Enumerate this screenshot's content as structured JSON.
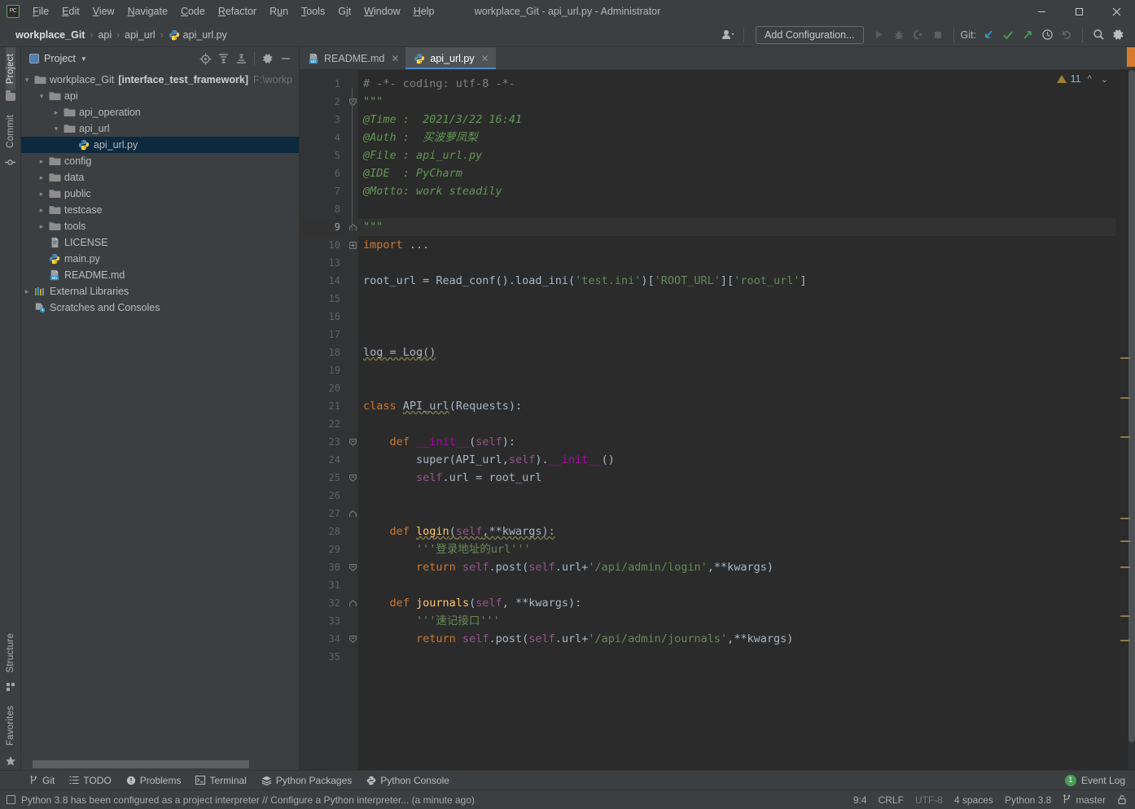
{
  "window": {
    "title": "workplace_Git - api_url.py - Administrator",
    "app_icon": "pycharm-logo-icon",
    "controls": {
      "minimize": "—",
      "maximize": "☐",
      "close": "✕"
    }
  },
  "menubar": {
    "items": [
      {
        "label": "File",
        "mnemonic": "F"
      },
      {
        "label": "Edit",
        "mnemonic": "E"
      },
      {
        "label": "View",
        "mnemonic": "V"
      },
      {
        "label": "Navigate",
        "mnemonic": "N"
      },
      {
        "label": "Code",
        "mnemonic": "C"
      },
      {
        "label": "Refactor",
        "mnemonic": "R"
      },
      {
        "label": "Run",
        "mnemonic": "u"
      },
      {
        "label": "Tools",
        "mnemonic": "T"
      },
      {
        "label": "Git",
        "mnemonic": "i"
      },
      {
        "label": "Window",
        "mnemonic": "W"
      },
      {
        "label": "Help",
        "mnemonic": "H"
      }
    ]
  },
  "navbar": {
    "breadcrumbs": [
      {
        "label": "workplace_Git",
        "bold": true,
        "icon": null
      },
      {
        "label": "api",
        "bold": false,
        "icon": null
      },
      {
        "label": "api_url",
        "bold": false,
        "icon": null
      },
      {
        "label": "api_url.py",
        "bold": false,
        "icon": "python-file-icon"
      }
    ],
    "separator": "›",
    "user_icon": "user-account-icon",
    "run_config_label": "Add Configuration...",
    "run_icon": "run-icon",
    "debug_icon": "debug-icon",
    "coverage_icon": "run-with-coverage-icon",
    "stop_icon": "stop-icon",
    "git_label": "Git:",
    "git_update_icon": "update-project-icon",
    "git_commit_icon": "commit-check-icon",
    "git_push_icon": "push-arrow-icon",
    "git_history_icon": "history-clock-icon",
    "git_rollback_icon": "rollback-icon",
    "search_icon": "search-icon",
    "settings_icon": "gear-icon"
  },
  "left_strip": {
    "top": [
      {
        "label": "Project",
        "icon": "project-folder-icon",
        "active": true
      },
      {
        "label": "Commit",
        "icon": "commit-icon",
        "active": false
      }
    ],
    "bottom": [
      {
        "label": "Structure",
        "icon": "structure-icon",
        "active": false
      },
      {
        "label": "Favorites",
        "icon": "star-icon",
        "active": false
      }
    ]
  },
  "project_panel": {
    "title": "Project",
    "title_icon": "project-view-icon",
    "dropdown_icon": "chevron-down-icon",
    "actions": [
      {
        "name": "scroll-from-source-icon"
      },
      {
        "name": "expand-all-icon"
      },
      {
        "name": "collapse-all-icon"
      },
      {
        "name": "gear-icon"
      },
      {
        "name": "hide-icon"
      }
    ],
    "tree": [
      {
        "depth": 0,
        "arrow": "down",
        "icon": "folder-icon",
        "label": "workplace_Git",
        "suffix": "[interface_test_framework]",
        "path": "F:\\workp",
        "selected": false
      },
      {
        "depth": 1,
        "arrow": "down",
        "icon": "folder-icon",
        "label": "api",
        "selected": false
      },
      {
        "depth": 2,
        "arrow": "right",
        "icon": "folder-icon",
        "label": "api_operation",
        "selected": false
      },
      {
        "depth": 2,
        "arrow": "down",
        "icon": "folder-icon",
        "label": "api_url",
        "selected": false
      },
      {
        "depth": 3,
        "arrow": "none",
        "icon": "python-file-icon",
        "label": "api_url.py",
        "selected": true
      },
      {
        "depth": 1,
        "arrow": "right",
        "icon": "folder-icon",
        "label": "config",
        "selected": false
      },
      {
        "depth": 1,
        "arrow": "right",
        "icon": "folder-icon",
        "label": "data",
        "selected": false
      },
      {
        "depth": 1,
        "arrow": "right",
        "icon": "folder-icon",
        "label": "public",
        "selected": false
      },
      {
        "depth": 1,
        "arrow": "right",
        "icon": "folder-icon",
        "label": "testcase",
        "selected": false
      },
      {
        "depth": 1,
        "arrow": "right",
        "icon": "folder-icon",
        "label": "tools",
        "selected": false
      },
      {
        "depth": 1,
        "arrow": "none",
        "icon": "license-file-icon",
        "label": "LICENSE",
        "selected": false
      },
      {
        "depth": 1,
        "arrow": "none",
        "icon": "python-file-icon",
        "label": "main.py",
        "selected": false
      },
      {
        "depth": 1,
        "arrow": "none",
        "icon": "markdown-file-icon",
        "label": "README.md",
        "selected": false
      },
      {
        "depth": 0,
        "arrow": "right",
        "icon": "external-libraries-icon",
        "label": "External Libraries",
        "selected": false
      },
      {
        "depth": 0,
        "arrow": "none",
        "icon": "scratches-icon",
        "label": "Scratches and Consoles",
        "selected": false
      }
    ]
  },
  "editor": {
    "tabs": [
      {
        "label": "README.md",
        "icon": "markdown-file-icon",
        "active": false,
        "close_icon": "close-icon"
      },
      {
        "label": "api_url.py",
        "icon": "python-file-icon",
        "active": true,
        "close_icon": "close-icon"
      }
    ],
    "inspector": {
      "warning_icon": "warning-triangle-icon",
      "warning_count": "11",
      "prev_icon": "chevron-up-icon",
      "next_icon": "chevron-down-icon"
    },
    "current_line": 9,
    "line_numbers": [
      1,
      2,
      3,
      4,
      5,
      6,
      7,
      8,
      9,
      10,
      13,
      14,
      15,
      16,
      17,
      18,
      19,
      20,
      21,
      22,
      23,
      24,
      25,
      26,
      27,
      28,
      29,
      30,
      31,
      32,
      33,
      34,
      35
    ],
    "code_lines": [
      {
        "n": 1,
        "html": "<span class=\"c-comment\"># -*- coding: utf-8 -*-</span>"
      },
      {
        "n": 2,
        "html": "<span class=\"c-doc\">\"\"\"</span>"
      },
      {
        "n": 3,
        "html": "<span class=\"c-doc\">@Time :  2021/3/22 16:41</span>"
      },
      {
        "n": 4,
        "html": "<span class=\"c-doc\">@Auth :  买波萝凤梨</span>"
      },
      {
        "n": 5,
        "html": "<span class=\"c-doc\">@File : api_url.py</span>"
      },
      {
        "n": 6,
        "html": "<span class=\"c-doc\">@IDE  : PyCharm</span>"
      },
      {
        "n": 7,
        "html": "<span class=\"c-doc\">@Motto: work steadily</span>"
      },
      {
        "n": 8,
        "html": ""
      },
      {
        "n": 9,
        "html": "<span class=\"c-doc\">\"\"\"</span>",
        "current": true
      },
      {
        "n": 10,
        "html": "<span class=\"c-kw\">import</span> <span class=\"c-default\">...</span>"
      },
      {
        "n": 13,
        "html": ""
      },
      {
        "n": 14,
        "html": "<span class=\"c-default\">root_url = Read_conf().load_ini(</span><span class=\"c-str\">'test.ini'</span><span class=\"c-default\">)[</span><span class=\"c-str\">'ROOT_URL'</span><span class=\"c-default\">][</span><span class=\"c-str\">'root_url'</span><span class=\"c-default\">]</span>"
      },
      {
        "n": 15,
        "html": ""
      },
      {
        "n": 16,
        "html": ""
      },
      {
        "n": 17,
        "html": ""
      },
      {
        "n": 18,
        "html": "<span class=\"c-default squig\">log = Log()</span>"
      },
      {
        "n": 19,
        "html": ""
      },
      {
        "n": 20,
        "html": ""
      },
      {
        "n": 21,
        "html": "<span class=\"c-kw\">class</span> <span class=\"c-default squig\">API_url</span><span class=\"c-default\">(Requests):</span>"
      },
      {
        "n": 22,
        "html": ""
      },
      {
        "n": 23,
        "html": "    <span class=\"c-kw\">def</span> <span class=\"c-dunder\">__init__</span><span class=\"c-default\">(</span><span class=\"c-self\">self</span><span class=\"c-default\">):</span>"
      },
      {
        "n": 24,
        "html": "        <span class=\"c-default\">super(API_url,</span><span class=\"c-self\">self</span><span class=\"c-default\">).</span><span class=\"c-dunder\">__init__</span><span class=\"c-default\">()</span>"
      },
      {
        "n": 25,
        "html": "        <span class=\"c-self\">self</span><span class=\"c-default\">.url = root_url</span>"
      },
      {
        "n": 26,
        "html": ""
      },
      {
        "n": 27,
        "html": ""
      },
      {
        "n": 28,
        "html": "    <span class=\"c-kw\">def</span> <span class=\"c-fn squig\">login</span><span class=\"c-default squig\">(</span><span class=\"c-self squig\">self</span><span class=\"c-default squig\">,**kwargs):</span>"
      },
      {
        "n": 29,
        "html": "        <span class=\"c-str\">'''登录地址的url'''</span>"
      },
      {
        "n": 30,
        "html": "        <span class=\"c-kw\">return</span> <span class=\"c-self\">self</span><span class=\"c-default\">.post(</span><span class=\"c-self\">self</span><span class=\"c-default\">.url+</span><span class=\"c-str\">'/api/admin/login'</span><span class=\"c-default\">,**kwargs)</span>"
      },
      {
        "n": 31,
        "html": ""
      },
      {
        "n": 32,
        "html": "    <span class=\"c-kw\">def</span> <span class=\"c-fn\">journals</span><span class=\"c-default\">(</span><span class=\"c-self\">self</span><span class=\"c-default\">, **kwargs):</span>"
      },
      {
        "n": 33,
        "html": "        <span class=\"c-str\">'''速记接口'''</span>"
      },
      {
        "n": 34,
        "html": "        <span class=\"c-kw\">return</span> <span class=\"c-self\">self</span><span class=\"c-default\">.post(</span><span class=\"c-self\">self</span><span class=\"c-default\">.url+</span><span class=\"c-str\">'/api/admin/journals'</span><span class=\"c-default\">,**kwargs)</span>"
      },
      {
        "n": 35,
        "html": ""
      }
    ],
    "fold_markers": [
      {
        "line_index": 1,
        "type": "minus"
      },
      {
        "line_index": 8,
        "type": "end"
      },
      {
        "line_index": 9,
        "type": "plus"
      },
      {
        "line_index": 20,
        "type": "minus"
      },
      {
        "line_index": 22,
        "type": "minus"
      },
      {
        "line_index": 24,
        "type": "end"
      },
      {
        "line_index": 27,
        "type": "minus"
      },
      {
        "line_index": 29,
        "type": "end"
      },
      {
        "line_index": 31,
        "type": "minus"
      },
      {
        "line_index": 33,
        "type": "end"
      }
    ],
    "scroll_markers_y": [
      443,
      492,
      540,
      640,
      668,
      700,
      760,
      790
    ],
    "top_right_marker_color": "#d57b2e"
  },
  "bottom_bar": {
    "items": [
      {
        "label": "Git",
        "icon": "git-branch-icon"
      },
      {
        "label": "TODO",
        "icon": "todo-list-icon"
      },
      {
        "label": "Problems",
        "icon": "problems-icon"
      },
      {
        "label": "Terminal",
        "icon": "terminal-icon"
      },
      {
        "label": "Python Packages",
        "icon": "packages-icon"
      },
      {
        "label": "Python Console",
        "icon": "python-console-icon"
      }
    ],
    "event_log": {
      "label": "Event Log",
      "count": "1",
      "badge_color": "#499c54"
    }
  },
  "status_bar": {
    "message_icon": "notification-icon",
    "message": "Python 3.8 has been configured as a project interpreter // Configure a Python interpreter... (a minute ago)",
    "caret_position": "9:4",
    "line_separator": "CRLF",
    "encoding": "UTF-8",
    "indent": "4 spaces",
    "interpreter": "Python 3.8",
    "branch_icon": "git-branch-icon",
    "branch": "master",
    "lock_icon": "lock-icon"
  },
  "colors": {
    "chrome_bg": "#3c3f41",
    "editor_bg": "#2b2b2b",
    "gutter_bg": "#313335",
    "selection_blue": "#0d293e",
    "tab_active_underline": "#4a88c7",
    "keyword_orange": "#cc7832",
    "string_green": "#6a8759",
    "docstring_green": "#629755",
    "function_yellow": "#ffc66d",
    "self_purple": "#94558d",
    "dunder_magenta": "#b200b2",
    "default_text": "#a9b7c6",
    "comment_gray": "#808080",
    "warning_amber": "#8a7a4a"
  }
}
